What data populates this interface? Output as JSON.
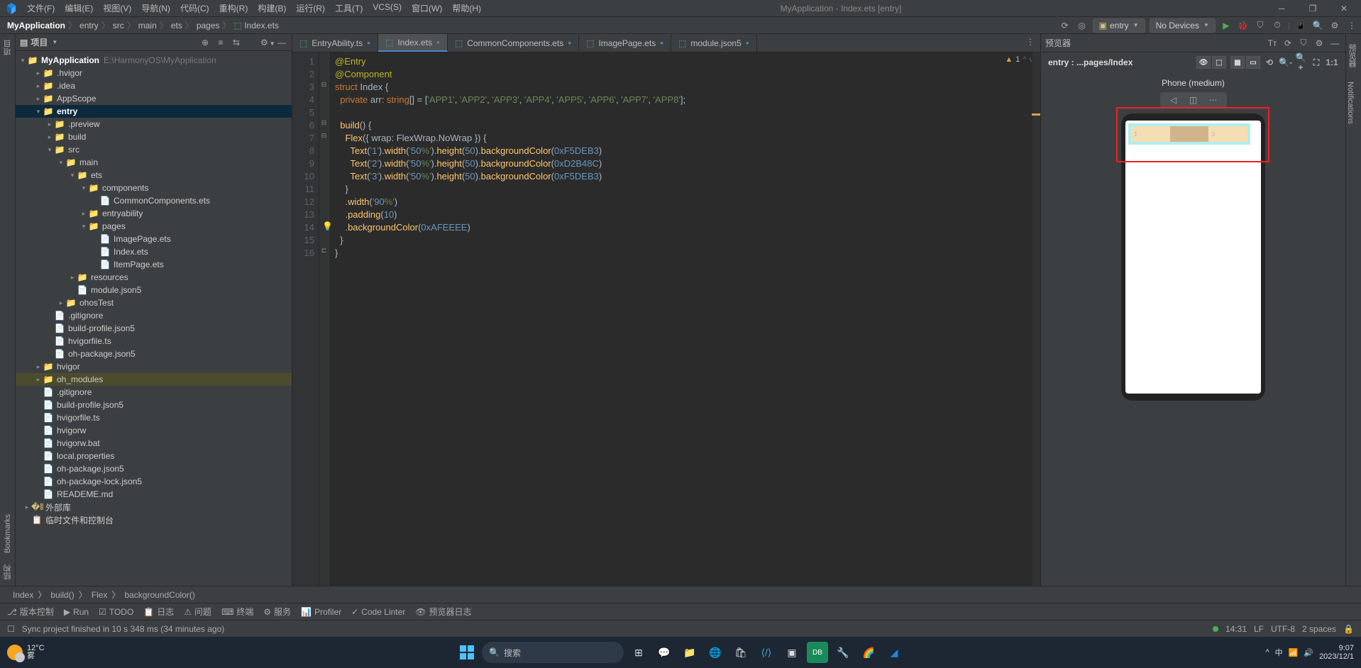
{
  "title_bar": {
    "menus": [
      "文件(F)",
      "编辑(E)",
      "视图(V)",
      "导航(N)",
      "代码(C)",
      "重构(R)",
      "构建(B)",
      "运行(R)",
      "工具(T)",
      "VCS(S)",
      "窗口(W)",
      "帮助(H)"
    ],
    "app_title": "MyApplication - Index.ets [entry]"
  },
  "breadcrumb": [
    "MyApplication",
    "entry",
    "src",
    "main",
    "ets",
    "pages"
  ],
  "breadcrumb_file": "Index.ets",
  "run_config": {
    "entry": "entry",
    "device": "No Devices"
  },
  "project": {
    "title": "项目",
    "root": {
      "name": "MyApplication",
      "path": "E:\\HarmonyOS\\MyApplication"
    },
    "tree": [
      {
        "d": 1,
        "type": "folder",
        "name": ".hvigor",
        "arrow": ">"
      },
      {
        "d": 1,
        "type": "folder",
        "name": ".idea",
        "arrow": ">"
      },
      {
        "d": 1,
        "type": "folder",
        "name": "AppScope",
        "arrow": ">"
      },
      {
        "d": 1,
        "type": "entry",
        "name": "entry",
        "arrow": "v",
        "selected": true
      },
      {
        "d": 2,
        "type": "folder",
        "name": ".preview",
        "arrow": ">"
      },
      {
        "d": 2,
        "type": "folder",
        "name": "build",
        "arrow": ">"
      },
      {
        "d": 2,
        "type": "folder",
        "name": "src",
        "arrow": "v"
      },
      {
        "d": 3,
        "type": "folder",
        "name": "main",
        "arrow": "v"
      },
      {
        "d": 4,
        "type": "folder",
        "name": "ets",
        "arrow": "v"
      },
      {
        "d": 5,
        "type": "folder",
        "name": "components",
        "arrow": "v"
      },
      {
        "d": 6,
        "type": "file",
        "name": "CommonComponents.ets"
      },
      {
        "d": 5,
        "type": "folder",
        "name": "entryability",
        "arrow": ">"
      },
      {
        "d": 5,
        "type": "folder",
        "name": "pages",
        "arrow": "v"
      },
      {
        "d": 6,
        "type": "file",
        "name": "ImagePage.ets"
      },
      {
        "d": 6,
        "type": "file",
        "name": "Index.ets"
      },
      {
        "d": 6,
        "type": "file",
        "name": "ItemPage.ets"
      },
      {
        "d": 4,
        "type": "folder",
        "name": "resources",
        "arrow": ">"
      },
      {
        "d": 4,
        "type": "file",
        "name": "module.json5"
      },
      {
        "d": 3,
        "type": "folder",
        "name": "ohosTest",
        "arrow": ">"
      },
      {
        "d": 2,
        "type": "file",
        "name": ".gitignore"
      },
      {
        "d": 2,
        "type": "file",
        "name": "build-profile.json5"
      },
      {
        "d": 2,
        "type": "file",
        "name": "hvigorfile.ts"
      },
      {
        "d": 2,
        "type": "file",
        "name": "oh-package.json5"
      },
      {
        "d": 1,
        "type": "folder",
        "name": "hvigor",
        "arrow": ">"
      },
      {
        "d": 1,
        "type": "oh",
        "name": "oh_modules",
        "arrow": ">"
      },
      {
        "d": 1,
        "type": "file",
        "name": ".gitignore"
      },
      {
        "d": 1,
        "type": "file",
        "name": "build-profile.json5"
      },
      {
        "d": 1,
        "type": "file",
        "name": "hvigorfile.ts"
      },
      {
        "d": 1,
        "type": "file",
        "name": "hvigorw"
      },
      {
        "d": 1,
        "type": "file",
        "name": "hvigorw.bat"
      },
      {
        "d": 1,
        "type": "file",
        "name": "local.properties"
      },
      {
        "d": 1,
        "type": "file",
        "name": "oh-package.json5"
      },
      {
        "d": 1,
        "type": "file",
        "name": "oh-package-lock.json5"
      },
      {
        "d": 1,
        "type": "file",
        "name": "READEME.md"
      },
      {
        "d": 0,
        "type": "lib",
        "name": "外部库",
        "arrow": ">"
      },
      {
        "d": 0,
        "type": "scratch",
        "name": "临时文件和控制台"
      }
    ]
  },
  "tabs": [
    {
      "name": "EntryAbility.ts",
      "modified": true
    },
    {
      "name": "Index.ets",
      "modified": true,
      "active": true
    },
    {
      "name": "CommonComponents.ets",
      "modified": true
    },
    {
      "name": "ImagePage.ets",
      "modified": true
    },
    {
      "name": "module.json5",
      "modified": true
    }
  ],
  "inspection": {
    "warnings": "1",
    "chev": "^ v"
  },
  "code_lines": [
    "@Entry",
    "@Component",
    "struct Index {",
    "  private arr: string[] = ['APP1', 'APP2', 'APP3', 'APP4', 'APP5', 'APP6', 'APP7', 'APP8'];",
    "",
    "  build() {",
    "    Flex({ wrap: FlexWrap.NoWrap }) {",
    "      Text('1').width('50%').height(50).backgroundColor(0xF5DEB3)",
    "      Text('2').width('50%').height(50).backgroundColor(0xD2B48C)",
    "      Text('3').width('50%').height(50).backgroundColor(0xF5DEB3)",
    "    }",
    "    .width('90%')",
    "    .padding(10)",
    "    .backgroundColor(0xAFEEEE)",
    "  }",
    "}"
  ],
  "line_nums": [
    "1",
    "2",
    "3",
    "4",
    "5",
    "6",
    "7",
    "8",
    "9",
    "10",
    "11",
    "12",
    "13",
    "14",
    "15",
    "16"
  ],
  "path_crumbs": [
    "Index",
    "build()",
    "Flex",
    "backgroundColor()"
  ],
  "tool_items": [
    "版本控制",
    "Run",
    "TODO",
    "日志",
    "问题",
    "终端",
    "服务",
    "Profiler",
    "Code Linter",
    "预览器日志"
  ],
  "status": {
    "sync": "Sync project finished in 10 s 348 ms (34 minutes ago)",
    "time": "14:31",
    "lf": "LF",
    "enc": "UTF-8",
    "spaces": "2 spaces"
  },
  "previewer": {
    "header": "预览器",
    "path": "entry : ...pages/Index",
    "device": "Phone (medium)"
  },
  "taskbar": {
    "temp": "12°C",
    "cond": "雾",
    "search": "搜索",
    "time": "9:07",
    "date": "2023/12/1"
  },
  "left_gutter_labels": [
    "项目",
    "Bookmarks",
    "结构"
  ]
}
